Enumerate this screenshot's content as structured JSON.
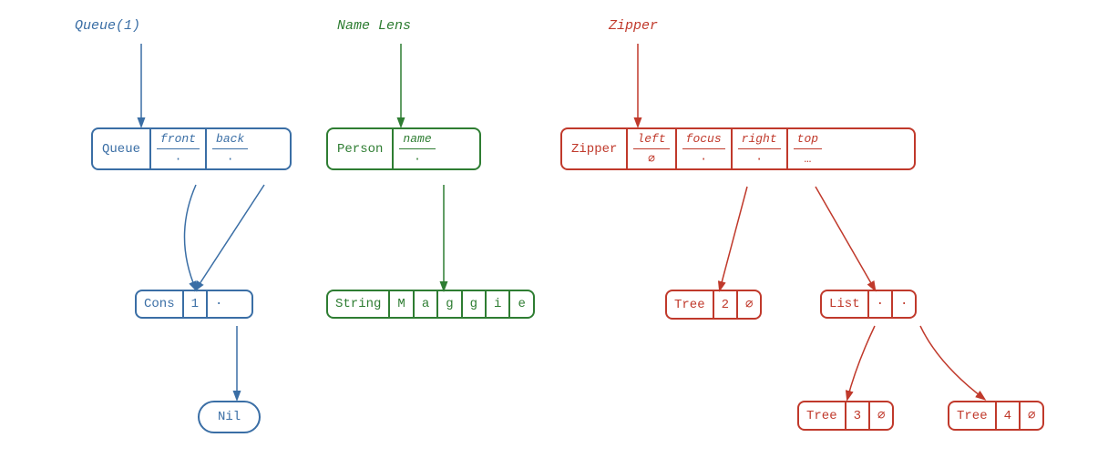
{
  "diagrams": {
    "queue": {
      "label": "Queue(1)",
      "label_color": "#3a6ea5",
      "queue_label": "Queue",
      "front_header": "front",
      "back_header": "back",
      "front_value": "·",
      "back_value": "·",
      "cons_label": "Cons",
      "cons_val": "1",
      "cons_dot": "·",
      "nil_label": "Nil"
    },
    "name_lens": {
      "label": "Name Lens",
      "label_color": "#2e7d32",
      "person_label": "Person",
      "name_header": "name",
      "name_value": "·",
      "string_label": "String",
      "chars": [
        "M",
        "a",
        "g",
        "g",
        "i",
        "e"
      ]
    },
    "zipper": {
      "label": "Zipper",
      "label_color": "#c0392b",
      "zipper_label": "Zipper",
      "left_header": "left",
      "focus_header": "focus",
      "right_header": "right",
      "top_header": "top",
      "left_value": "∅",
      "focus_value": "·",
      "right_value": "·",
      "top_value": "…",
      "tree1_label": "Tree",
      "tree1_val": "2",
      "tree1_dot": "∅",
      "list_label": "List",
      "list_dot1": "·",
      "list_dot2": "·",
      "tree2_label": "Tree",
      "tree2_val": "3",
      "tree2_dot": "∅",
      "tree3_label": "Tree",
      "tree3_val": "4",
      "tree3_dot": "∅"
    }
  }
}
